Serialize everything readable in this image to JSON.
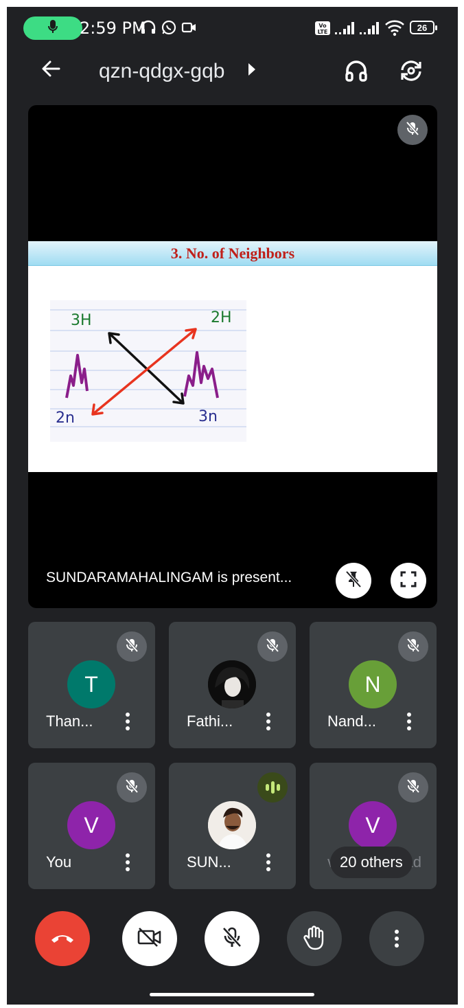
{
  "status_bar": {
    "time": "2:59 PM",
    "battery": "26",
    "colors": {
      "mic_pill": "#3ddc84"
    }
  },
  "app_bar": {
    "meeting_code": "qzn-qdgx-gqb",
    "icons": [
      "back-arrow-icon",
      "headphones-icon",
      "switch-camera-icon"
    ]
  },
  "presentation": {
    "slide_title": "3. No. of Neighbors",
    "sketch_labels": {
      "top_left": "3H",
      "top_right": "2H",
      "bottom_left": "2n",
      "bottom_right": "3n"
    },
    "presenter_label": "SUNDARAMAHALINGAM is present...",
    "colors": {
      "slide_title": "#c0201a"
    }
  },
  "participants": [
    {
      "name": "Than...",
      "initial": "T",
      "avatar_color": "#00796b",
      "mic": "muted"
    },
    {
      "name": "Fathi...",
      "initial": "",
      "avatar_color": "#111111",
      "mic": "muted"
    },
    {
      "name": "Nand...",
      "initial": "N",
      "avatar_color": "#689f38",
      "mic": "muted"
    },
    {
      "name": "You",
      "initial": "V",
      "avatar_color": "#8e24aa",
      "mic": "muted"
    },
    {
      "name": "SUN...",
      "initial": "",
      "avatar_color": "#f4f0ea",
      "mic": "speaking"
    },
    {
      "name": "vishnu prasad",
      "initial": "V",
      "avatar_color": "#8e24aa",
      "mic": "muted",
      "overlay": "20 others"
    }
  ],
  "controls": {
    "icons": [
      "end-call-icon",
      "camera-off-icon",
      "mic-off-icon",
      "raise-hand-icon",
      "more-options-icon"
    ],
    "colors": {
      "end_call": "#ea4335"
    }
  }
}
